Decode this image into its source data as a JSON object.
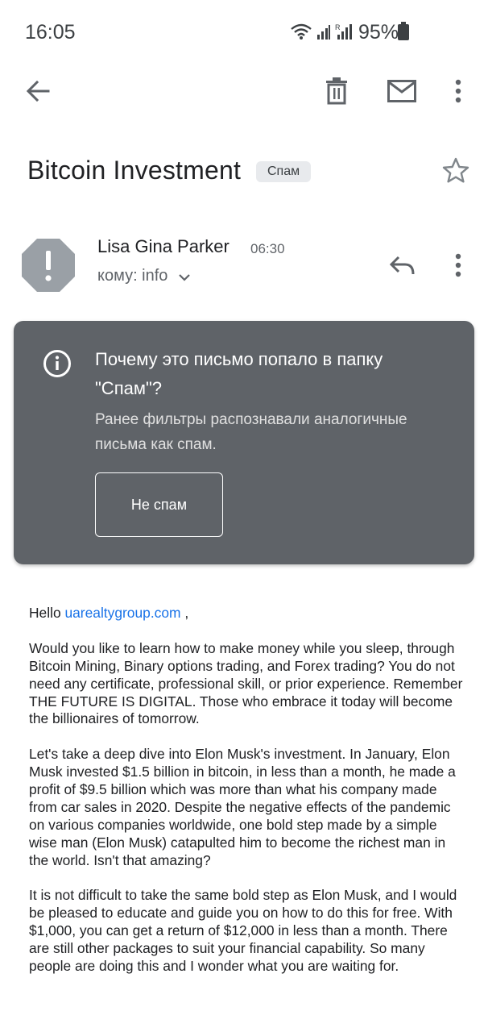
{
  "status_bar": {
    "time": "16:05",
    "battery_percent": "95%"
  },
  "toolbar": {
    "icons": [
      "back-arrow-icon",
      "trash-icon",
      "mail-icon",
      "more-vertical-icon"
    ]
  },
  "email": {
    "subject": "Bitcoin Investment",
    "label": "Спам",
    "sender_name": "Lisa Gina Parker",
    "time": "06:30",
    "recipient": "кому: info"
  },
  "spam_warning": {
    "title": "Почему это письмо попало в папку \"Спам\"?",
    "description": "Ранее фильтры распознавали аналогичные письма как спам.",
    "button_label": "Не спам"
  },
  "body": {
    "greeting_prefix": "Hello ",
    "greeting_link": "uarealtygroup.com",
    "greeting_suffix": " ,",
    "paragraph_1": "Would you like to learn how to make money while you sleep, through Bitcoin Mining, Binary options trading, and Forex trading? You do not need any certificate, professional skill, or prior experience. Remember THE FUTURE IS DIGITAL. Those who embrace it today will become the billionaires of tomorrow.",
    "paragraph_2": "Let's take a deep dive into Elon Musk's investment. In January, Elon Musk invested $1.5 billion in bitcoin, in less than a month, he made a profit of $9.5 billion which was more than what his company made from car sales in 2020. Despite the negative effects of the pandemic on various companies worldwide, one bold step made by a simple wise man (Elon Musk) catapulted him to become the richest man in the world. Isn't that amazing?",
    "paragraph_3": "It is not difficult to take the same bold step as Elon Musk, and I would be pleased to educate and guide you on how to do this for free. With $1,000, you can get a return of $12,000 in less than a month. There are still other packages to suit your financial capability. So many people are doing this and I wonder what you are waiting for."
  }
}
